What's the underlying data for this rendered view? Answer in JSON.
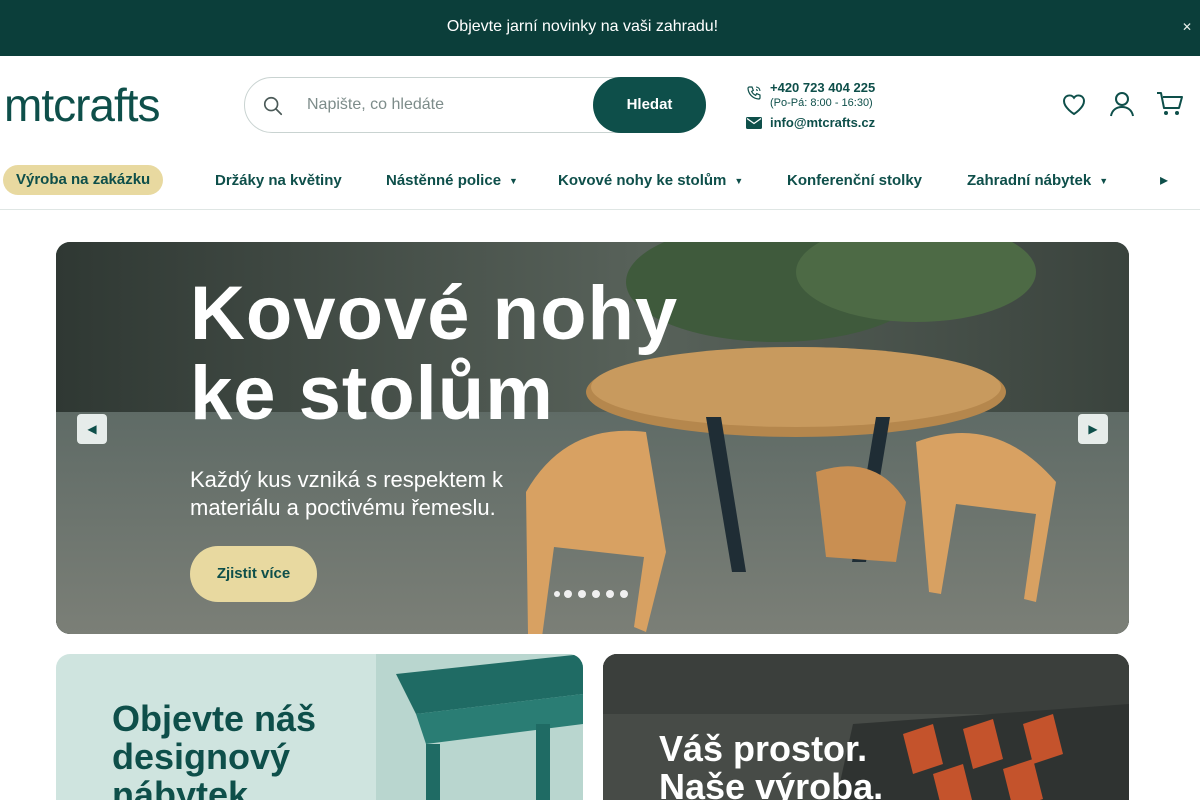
{
  "announcement": {
    "text": "Objevte jarní novinky na vaši zahradu!",
    "close_icon": "close-icon"
  },
  "header": {
    "logo_text": "mtcrafts",
    "search": {
      "placeholder": "Napište, co hledáte",
      "button_label": "Hledat",
      "icon": "search-icon"
    },
    "contact": {
      "phone": "+420 723 404 225",
      "hours": "(Po-Pá: 8:00 - 16:30)",
      "email": "info@mtcrafts.cz"
    },
    "icons": [
      "heart-icon",
      "user-icon",
      "cart-icon"
    ]
  },
  "nav": {
    "highlight": "Výroba na zakázku",
    "items": [
      {
        "label": "Držáky na květiny",
        "dropdown": false
      },
      {
        "label": "Nástěnné police",
        "dropdown": true
      },
      {
        "label": "Kovové nohy ke stolům",
        "dropdown": true
      },
      {
        "label": "Konferenční stolky",
        "dropdown": false
      },
      {
        "label": "Zahradní nábytek",
        "dropdown": true
      }
    ]
  },
  "hero": {
    "title_line1": "Kovové nohy",
    "title_line2": "ke stolům",
    "subtitle": "Každý kus vzniká s respektem k materiálu a poctivému řemeslu.",
    "cta": "Zjistit více",
    "slides_count": 6,
    "active_slide": 1
  },
  "cards": {
    "left_title": "Objevte náš designový nábytek",
    "right_title_line1": "Váš prostor.",
    "right_title_line2": "Naše výroba."
  },
  "colors": {
    "brand": "#0e4f4a",
    "accent": "#e8d9a0",
    "topbar": "#0b3e3a"
  }
}
